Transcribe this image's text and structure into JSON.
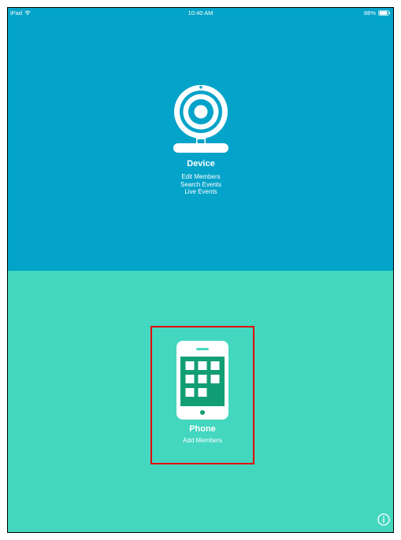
{
  "status_bar": {
    "device": "iPad",
    "time": "10:40 AM",
    "battery": "88%",
    "wifi_icon": "wifi-icon",
    "battery_icon": "battery-icon"
  },
  "device_option": {
    "icon": "webcam-icon",
    "title": "Device",
    "actions": [
      "Edit Members",
      "Search Events",
      "Live Events"
    ]
  },
  "phone_option": {
    "icon": "phone-icon",
    "title": "Phone",
    "actions": [
      "Add Members"
    ]
  },
  "info_button": {
    "icon": "info-icon"
  },
  "colors": {
    "top_panel": "#04a3c9",
    "bottom_panel": "#43d7bf",
    "phone_screen": "#129e74",
    "highlight_border": "#e60000"
  }
}
